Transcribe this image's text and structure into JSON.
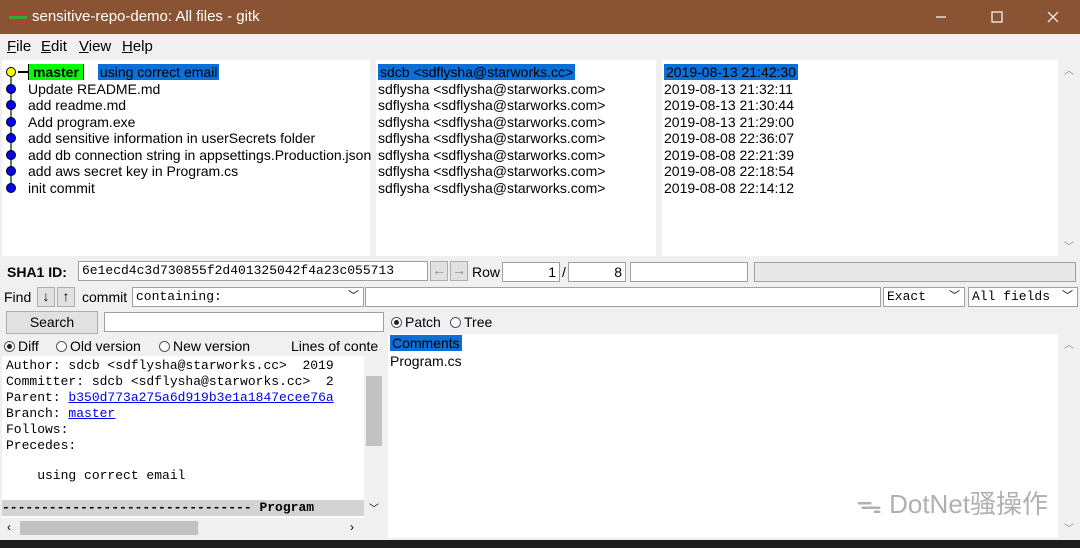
{
  "window": {
    "title": "sensitive-repo-demo: All files - gitk",
    "minimize": "—",
    "maximize": "☐",
    "close": "✕"
  },
  "menu": [
    "File",
    "Edit",
    "View",
    "Help"
  ],
  "commits": [
    {
      "branch": "master",
      "message": "using correct email",
      "author": "sdcb <sdflysha@starworks.cc>",
      "date": "2019-08-13 21:42:30",
      "selected": true
    },
    {
      "message": "Update README.md",
      "author": "sdflysha <sdflysha@starworks.com>",
      "date": "2019-08-13 21:32:11"
    },
    {
      "message": "add readme.md",
      "author": "sdflysha <sdflysha@starworks.com>",
      "date": "2019-08-13 21:30:44"
    },
    {
      "message": "Add program.exe",
      "author": "sdflysha <sdflysha@starworks.com>",
      "date": "2019-08-13 21:29:00"
    },
    {
      "message": "add sensitive information in userSecrets folder",
      "author": "sdflysha <sdflysha@starworks.com>",
      "date": "2019-08-08 22:36:07"
    },
    {
      "message": "add db connection string in appsettings.Production.json",
      "author": "sdflysha <sdflysha@starworks.com>",
      "date": "2019-08-08 22:21:39"
    },
    {
      "message": "add aws secret key in Program.cs",
      "author": "sdflysha <sdflysha@starworks.com>",
      "date": "2019-08-08 22:18:54"
    },
    {
      "message": "init commit",
      "author": "sdflysha <sdflysha@starworks.com>",
      "date": "2019-08-08 22:14:12"
    }
  ],
  "sha": {
    "label": "SHA1 ID:",
    "value": "6e1ecd4c3d730855f2d401325042f4a23c055713",
    "row_label": "Row",
    "row_current": "1",
    "row_sep": "/",
    "row_total": "8"
  },
  "find": {
    "label": "Find",
    "commit_label": "commit",
    "mode": "containing:",
    "match": "Exact",
    "fields": "All fields",
    "search_button": "Search"
  },
  "diff_options": {
    "diff": "Diff",
    "old": "Old version",
    "new": "New version",
    "context": "Lines of conte"
  },
  "patch_tree": {
    "patch": "Patch",
    "tree": "Tree"
  },
  "details": {
    "author": "Author: sdcb <sdflysha@starworks.cc>  2019",
    "committer": "Committer: sdcb <sdflysha@starworks.cc>  2",
    "parent_label": "Parent: ",
    "parent_hash": "b350d773a275a6d919b3e1a1847ecee76a",
    "branch_label": "Branch: ",
    "branch": "master",
    "follows": "Follows:",
    "precedes": "Precedes:",
    "message": "    using correct email",
    "file_header": "-------------------------------- Program"
  },
  "files": [
    "Comments",
    "Program.cs"
  ],
  "watermark": "DotNet骚操作"
}
